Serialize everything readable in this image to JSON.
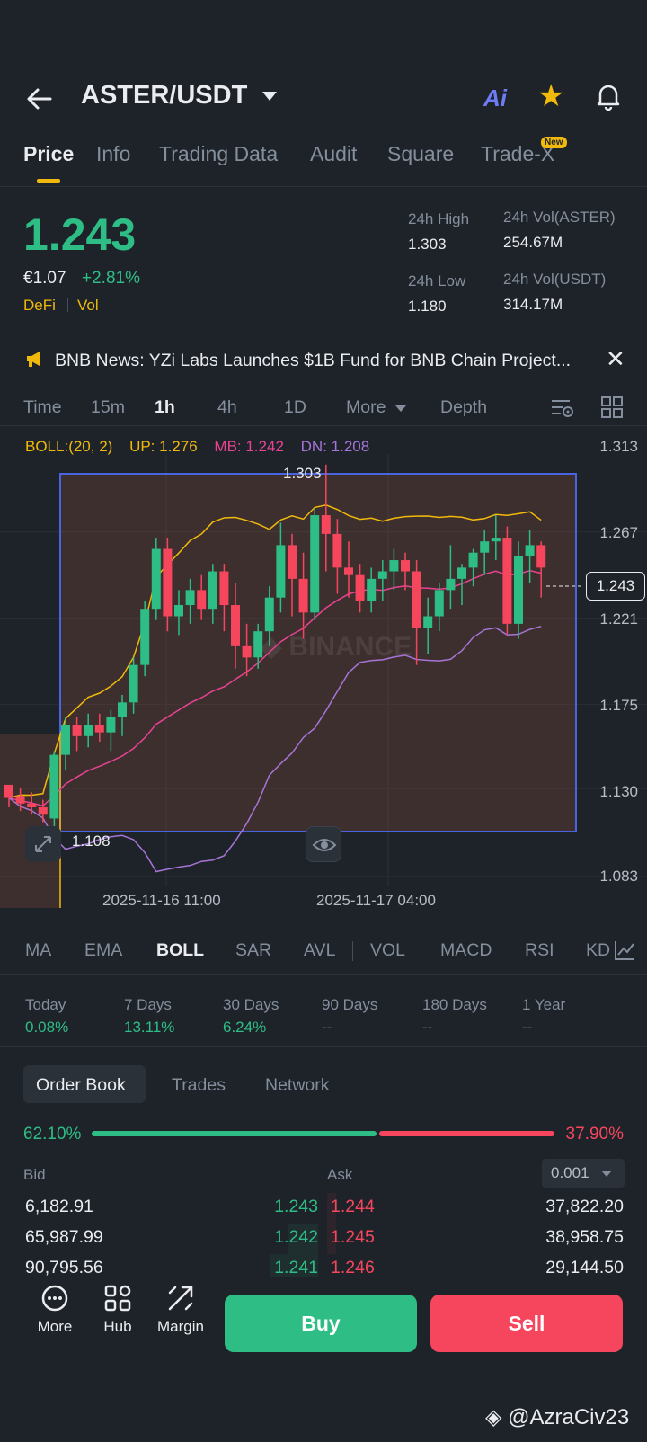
{
  "header": {
    "pair": "ASTER/USDT",
    "ai_label": "Ai"
  },
  "tabs": [
    {
      "label": "Price",
      "active": true
    },
    {
      "label": "Info"
    },
    {
      "label": "Trading Data"
    },
    {
      "label": "Audit"
    },
    {
      "label": "Square"
    },
    {
      "label": "Trade-X",
      "badge": "New"
    }
  ],
  "price": {
    "last": "1.243",
    "fiat": "€1.07",
    "change_pct": "+2.81%",
    "tag1": "DeFi",
    "tag2": "Vol"
  },
  "stats": {
    "high_label": "24h High",
    "high": "1.303",
    "low_label": "24h Low",
    "low": "1.180",
    "vol_base_label": "24h Vol(ASTER)",
    "vol_base": "254.67M",
    "vol_quote_label": "24h Vol(USDT)",
    "vol_quote": "314.17M"
  },
  "news": {
    "text": "BNB News: YZi Labs Launches $1B Fund for BNB Chain Project..."
  },
  "intervals": {
    "time": "Time",
    "m15": "15m",
    "h1": "1h",
    "h4": "4h",
    "d1": "1D",
    "more": "More",
    "depth": "Depth",
    "active": "1h"
  },
  "boll": {
    "label": "BOLL:(20, 2)",
    "up": "UP: 1.276",
    "mb": "MB: 1.242",
    "dn": "DN: 1.208",
    "colors": {
      "up": "#f0b90b",
      "mb": "#e84393",
      "dn": "#a774d8"
    }
  },
  "chart_data": {
    "type": "candlestick",
    "y_ticks": [
      "1.313",
      "1.267",
      "1.221",
      "1.175",
      "1.130",
      "1.083"
    ],
    "ylim": [
      1.083,
      1.313
    ],
    "x_ticks": [
      "2025-11-16 11:00",
      "2025-11-17 04:00"
    ],
    "current_price_label": "1.243",
    "high_marker": "1.303",
    "low_marker": "1.108",
    "watermark": "BINANCE",
    "candles": [
      [
        1.132,
        1.132,
        1.12,
        1.125
      ],
      [
        1.126,
        1.13,
        1.118,
        1.122
      ],
      [
        1.122,
        1.128,
        1.116,
        1.12
      ],
      [
        1.12,
        1.124,
        1.112,
        1.116
      ],
      [
        1.114,
        1.15,
        1.108,
        1.148
      ],
      [
        1.148,
        1.168,
        1.14,
        1.164
      ],
      [
        1.164,
        1.168,
        1.15,
        1.158
      ],
      [
        1.158,
        1.17,
        1.152,
        1.164
      ],
      [
        1.164,
        1.17,
        1.155,
        1.16
      ],
      [
        1.16,
        1.172,
        1.15,
        1.168
      ],
      [
        1.168,
        1.18,
        1.158,
        1.176
      ],
      [
        1.176,
        1.2,
        1.17,
        1.196
      ],
      [
        1.196,
        1.23,
        1.19,
        1.226
      ],
      [
        1.226,
        1.264,
        1.22,
        1.258
      ],
      [
        1.258,
        1.264,
        1.214,
        1.222
      ],
      [
        1.222,
        1.236,
        1.212,
        1.228
      ],
      [
        1.228,
        1.242,
        1.218,
        1.236
      ],
      [
        1.236,
        1.244,
        1.22,
        1.226
      ],
      [
        1.226,
        1.25,
        1.218,
        1.246
      ],
      [
        1.246,
        1.25,
        1.214,
        1.228
      ],
      [
        1.228,
        1.24,
        1.194,
        1.206
      ],
      [
        1.206,
        1.218,
        1.19,
        1.2
      ],
      [
        1.2,
        1.218,
        1.194,
        1.214
      ],
      [
        1.214,
        1.238,
        1.206,
        1.232
      ],
      [
        1.232,
        1.272,
        1.224,
        1.26
      ],
      [
        1.26,
        1.266,
        1.222,
        1.242
      ],
      [
        1.242,
        1.256,
        1.21,
        1.224
      ],
      [
        1.224,
        1.28,
        1.22,
        1.276
      ],
      [
        1.276,
        1.303,
        1.246,
        1.266
      ],
      [
        1.266,
        1.274,
        1.234,
        1.248
      ],
      [
        1.248,
        1.262,
        1.232,
        1.244
      ],
      [
        1.244,
        1.25,
        1.224,
        1.23
      ],
      [
        1.23,
        1.248,
        1.224,
        1.242
      ],
      [
        1.242,
        1.252,
        1.23,
        1.246
      ],
      [
        1.246,
        1.258,
        1.236,
        1.252
      ],
      [
        1.252,
        1.256,
        1.236,
        1.246
      ],
      [
        1.246,
        1.252,
        1.196,
        1.216
      ],
      [
        1.216,
        1.232,
        1.202,
        1.222
      ],
      [
        1.222,
        1.24,
        1.214,
        1.236
      ],
      [
        1.236,
        1.26,
        1.226,
        1.242
      ],
      [
        1.242,
        1.25,
        1.228,
        1.248
      ],
      [
        1.248,
        1.258,
        1.238,
        1.256
      ],
      [
        1.256,
        1.268,
        1.244,
        1.262
      ],
      [
        1.262,
        1.276,
        1.252,
        1.264
      ],
      [
        1.264,
        1.27,
        1.212,
        1.218
      ],
      [
        1.218,
        1.262,
        1.21,
        1.254
      ],
      [
        1.254,
        1.268,
        1.24,
        1.26
      ],
      [
        1.26,
        1.262,
        1.232,
        1.248
      ]
    ]
  },
  "indicators": [
    "MA",
    "EMA",
    "BOLL",
    "SAR",
    "AVL",
    "VOL",
    "MACD",
    "RSI",
    "KD"
  ],
  "indicator_active": "BOLL",
  "performance": [
    {
      "label": "Today",
      "value": "0.08%",
      "color": "green"
    },
    {
      "label": "7 Days",
      "value": "13.11%",
      "color": "green"
    },
    {
      "label": "30 Days",
      "value": "6.24%",
      "color": "green"
    },
    {
      "label": "90 Days",
      "value": "--",
      "color": "muted"
    },
    {
      "label": "180 Days",
      "value": "--",
      "color": "muted"
    },
    {
      "label": "1 Year",
      "value": "--",
      "color": "muted"
    }
  ],
  "orderbook": {
    "tabs": [
      "Order Book",
      "Trades",
      "Network"
    ],
    "bid_pct": "62.10%",
    "ask_pct": "37.90%",
    "bid_ratio": 0.621,
    "bid_header": "Bid",
    "ask_header": "Ask",
    "precision": "0.001",
    "rows": [
      {
        "bid_qty": "6,182.91",
        "bid_px": "1.243",
        "ask_px": "1.244",
        "ask_qty": "37,822.20"
      },
      {
        "bid_qty": "65,987.99",
        "bid_px": "1.242",
        "ask_px": "1.245",
        "ask_qty": "38,958.75"
      },
      {
        "bid_qty": "90,795.56",
        "bid_px": "1.241",
        "ask_px": "1.246",
        "ask_qty": "29,144.50"
      }
    ]
  },
  "bottom": {
    "more": "More",
    "hub": "Hub",
    "margin": "Margin",
    "buy": "Buy",
    "sell": "Sell"
  },
  "watermark": {
    "handle": "@AzraCiv23"
  }
}
